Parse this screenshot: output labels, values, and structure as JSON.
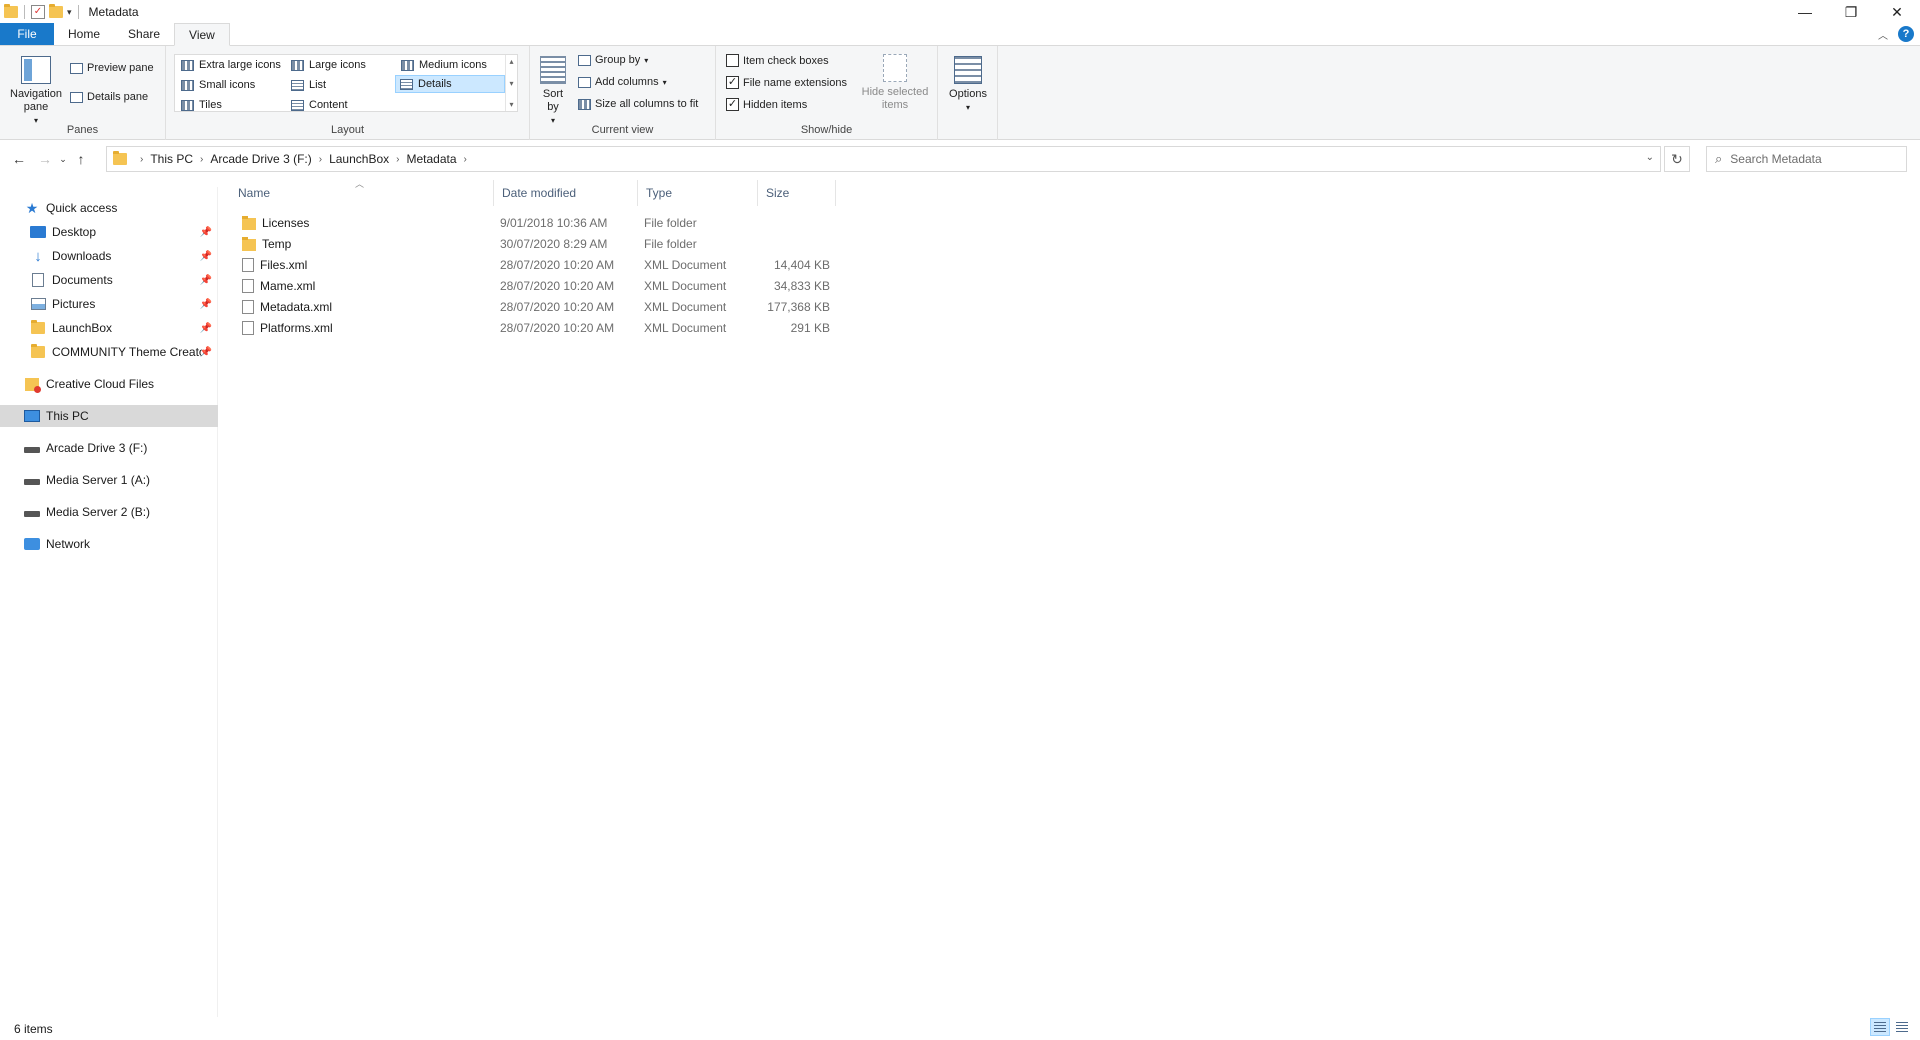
{
  "window": {
    "title": "Metadata"
  },
  "ribbon": {
    "tabs": [
      "File",
      "Home",
      "Share",
      "View"
    ],
    "panes": {
      "label": "Panes",
      "navigation_pane": "Navigation pane",
      "preview_pane": "Preview pane",
      "details_pane": "Details pane"
    },
    "layout": {
      "label": "Layout",
      "items": [
        "Extra large icons",
        "Large icons",
        "Medium icons",
        "Small icons",
        "List",
        "Details",
        "Tiles",
        "Content"
      ],
      "selected": "Details"
    },
    "current_view": {
      "label": "Current view",
      "sort_by": "Sort by",
      "group_by": "Group by",
      "add_columns": "Add columns",
      "size_all_columns": "Size all columns to fit"
    },
    "show_hide": {
      "label": "Show/hide",
      "item_check_boxes": "Item check boxes",
      "file_name_extensions": "File name extensions",
      "hidden_items": "Hidden items",
      "hide_selected_items": "Hide selected items"
    },
    "options": "Options"
  },
  "address": {
    "crumbs": [
      "This PC",
      "Arcade Drive 3 (F:)",
      "LaunchBox",
      "Metadata"
    ],
    "search_placeholder": "Search Metadata"
  },
  "sidebar": {
    "items": [
      {
        "label": "Quick access",
        "icon": "star-icon"
      },
      {
        "label": "Desktop",
        "icon": "desktop-icon",
        "pinned": true
      },
      {
        "label": "Downloads",
        "icon": "download-icon",
        "pinned": true
      },
      {
        "label": "Documents",
        "icon": "documents-icon",
        "pinned": true
      },
      {
        "label": "Pictures",
        "icon": "pictures-icon",
        "pinned": true
      },
      {
        "label": "LaunchBox",
        "icon": "folder-icon",
        "pinned": true
      },
      {
        "label": "COMMUNITY Theme Creato",
        "icon": "folder-icon",
        "pinned": true
      },
      {
        "label": "Creative Cloud Files",
        "icon": "creative-cloud-icon"
      },
      {
        "label": "This PC",
        "icon": "computer-icon",
        "selected": true
      },
      {
        "label": "Arcade Drive 3 (F:)",
        "icon": "drive-icon"
      },
      {
        "label": "Media Server 1 (A:)",
        "icon": "drive-icon"
      },
      {
        "label": "Media Server 2 (B:)",
        "icon": "drive-icon"
      },
      {
        "label": "Network",
        "icon": "network-icon"
      }
    ]
  },
  "filelist": {
    "columns": [
      "Name",
      "Date modified",
      "Type",
      "Size"
    ],
    "rows": [
      {
        "name": "Licenses",
        "date": "9/01/2018 10:36 AM",
        "type": "File folder",
        "size": "",
        "kind": "folder"
      },
      {
        "name": "Temp",
        "date": "30/07/2020 8:29 AM",
        "type": "File folder",
        "size": "",
        "kind": "folder"
      },
      {
        "name": "Files.xml",
        "date": "28/07/2020 10:20 AM",
        "type": "XML Document",
        "size": "14,404 KB",
        "kind": "file"
      },
      {
        "name": "Mame.xml",
        "date": "28/07/2020 10:20 AM",
        "type": "XML Document",
        "size": "34,833 KB",
        "kind": "file"
      },
      {
        "name": "Metadata.xml",
        "date": "28/07/2020 10:20 AM",
        "type": "XML Document",
        "size": "177,368 KB",
        "kind": "file"
      },
      {
        "name": "Platforms.xml",
        "date": "28/07/2020 10:20 AM",
        "type": "XML Document",
        "size": "291 KB",
        "kind": "file"
      }
    ]
  },
  "status": {
    "item_count": "6 items"
  },
  "colors": {
    "accent": "#1979ca",
    "selection": "#cce8ff",
    "folder": "#f5c453"
  }
}
